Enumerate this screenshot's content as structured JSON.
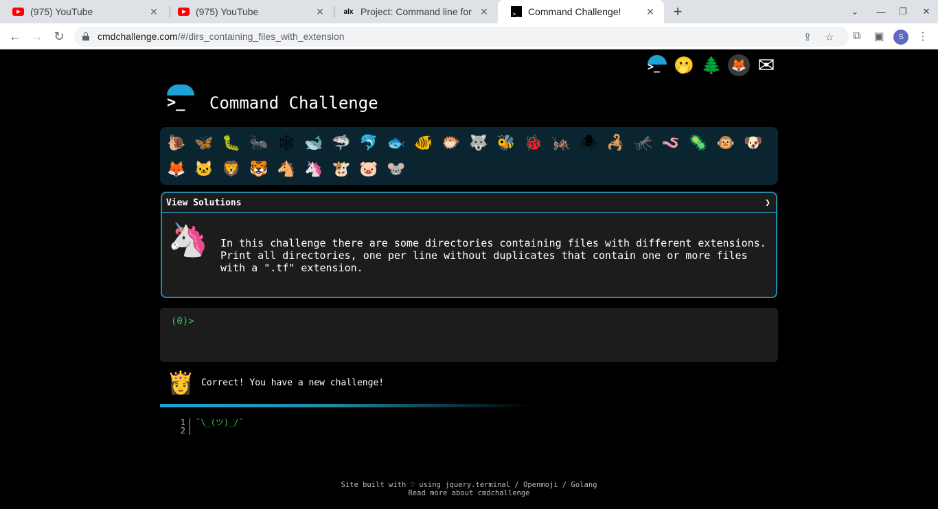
{
  "browser": {
    "tabs": [
      {
        "title": "(975) YouTube",
        "favicon": "youtube-icon"
      },
      {
        "title": "(975) YouTube",
        "favicon": "youtube-icon"
      },
      {
        "title": "Project: Command line for",
        "favicon": "alx-icon"
      },
      {
        "title": "Command Challenge!",
        "favicon": "terminal-icon",
        "active": true
      }
    ],
    "close_glyph": "✕",
    "new_tab_glyph": "+",
    "url_host": "cmdchallenge.com",
    "url_path": "/#/dirs_containing_files_with_extension",
    "profile_initial": "S"
  },
  "site": {
    "title": "Command Challenge",
    "top_links": [
      {
        "name": "cmdchallenge-link",
        "glyph": ">_"
      },
      {
        "name": "oops-link",
        "glyph": "🫢"
      },
      {
        "name": "12days-link",
        "glyph": "🌲"
      },
      {
        "name": "gitlab-link",
        "glyph": "🦊"
      },
      {
        "name": "contact-link",
        "glyph": "✉"
      }
    ],
    "challenges": [
      "🐌",
      "🦋",
      "🐛",
      "🐜",
      "🕸",
      "🐋",
      "🦈",
      "🐬",
      "🐟",
      "🐠",
      "🐡",
      "🐺",
      "🐝",
      "🐞",
      "🦗",
      "🕷",
      "🦂",
      "🦟",
      "🪱",
      "🦠",
      "🐵",
      "🐶",
      "🦊",
      "🐱",
      "🦁",
      "🐯",
      "🐴",
      "🦄",
      "🐮",
      "🐷",
      "🐭"
    ],
    "panel": {
      "header": "View Solutions",
      "header_chevron": "❯",
      "icon": "🦄",
      "description": "In this challenge there are some directories containing files with different extensions. Print all directories, one per line without duplicates that contain one or more files with a \".tf\" extension."
    },
    "terminal": {
      "prompt": "(0)>"
    },
    "result": {
      "icon": "👸",
      "message": "Correct! You have a new challenge!"
    },
    "code_lines": [
      {
        "num": "1",
        "text": "¯\\_(ツ)_/¯"
      },
      {
        "num": "2",
        "text": ""
      }
    ],
    "footer": {
      "line1": "Site built with ♡ using jquery.terminal / Openmoji / Golang",
      "line2": "Read more about cmdchallenge"
    }
  }
}
